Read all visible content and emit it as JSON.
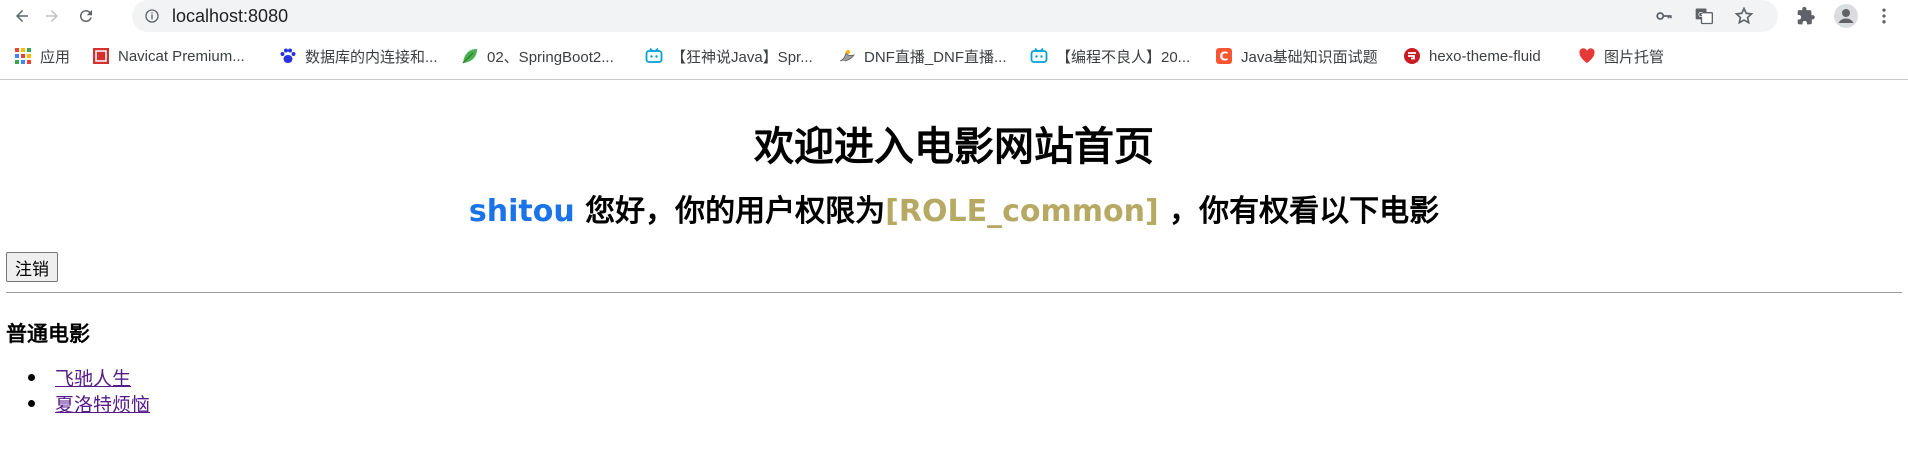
{
  "browser": {
    "url": "localhost:8080",
    "bookmarks": [
      {
        "label": "应用",
        "icon": "apps-grid-icon"
      },
      {
        "label": "Navicat Premium...",
        "icon": "navicat-icon"
      },
      {
        "label": "数据库的内连接和...",
        "icon": "baidu-paw-icon"
      },
      {
        "label": "02、SpringBoot2...",
        "icon": "leaf-icon"
      },
      {
        "label": "【狂神说Java】Spr...",
        "icon": "bilibili-icon"
      },
      {
        "label": "DNF直播_DNF直播...",
        "icon": "dnf-bird-icon"
      },
      {
        "label": "【编程不良人】20...",
        "icon": "bilibili-icon"
      },
      {
        "label": "Java基础知识面试题",
        "icon": "csdn-c-icon"
      },
      {
        "label": "hexo-theme-fluid",
        "icon": "gitee-icon"
      },
      {
        "label": "图片托管",
        "icon": "heart-icon"
      }
    ]
  },
  "page": {
    "title": "欢迎进入电影网站首页",
    "greeting": {
      "username": "shitou",
      "mid": " 您好，你的用户权限为",
      "role": "[ROLE_common]",
      "end": " ，你有权看以下电影"
    },
    "logout_label": "注销",
    "section_title": "普通电影",
    "movies": [
      "飞驰人生",
      "夏洛特烦恼"
    ]
  },
  "colors": {
    "username": "#1a73e8",
    "role": "#b5a964",
    "link_visited": "#551a8b"
  }
}
